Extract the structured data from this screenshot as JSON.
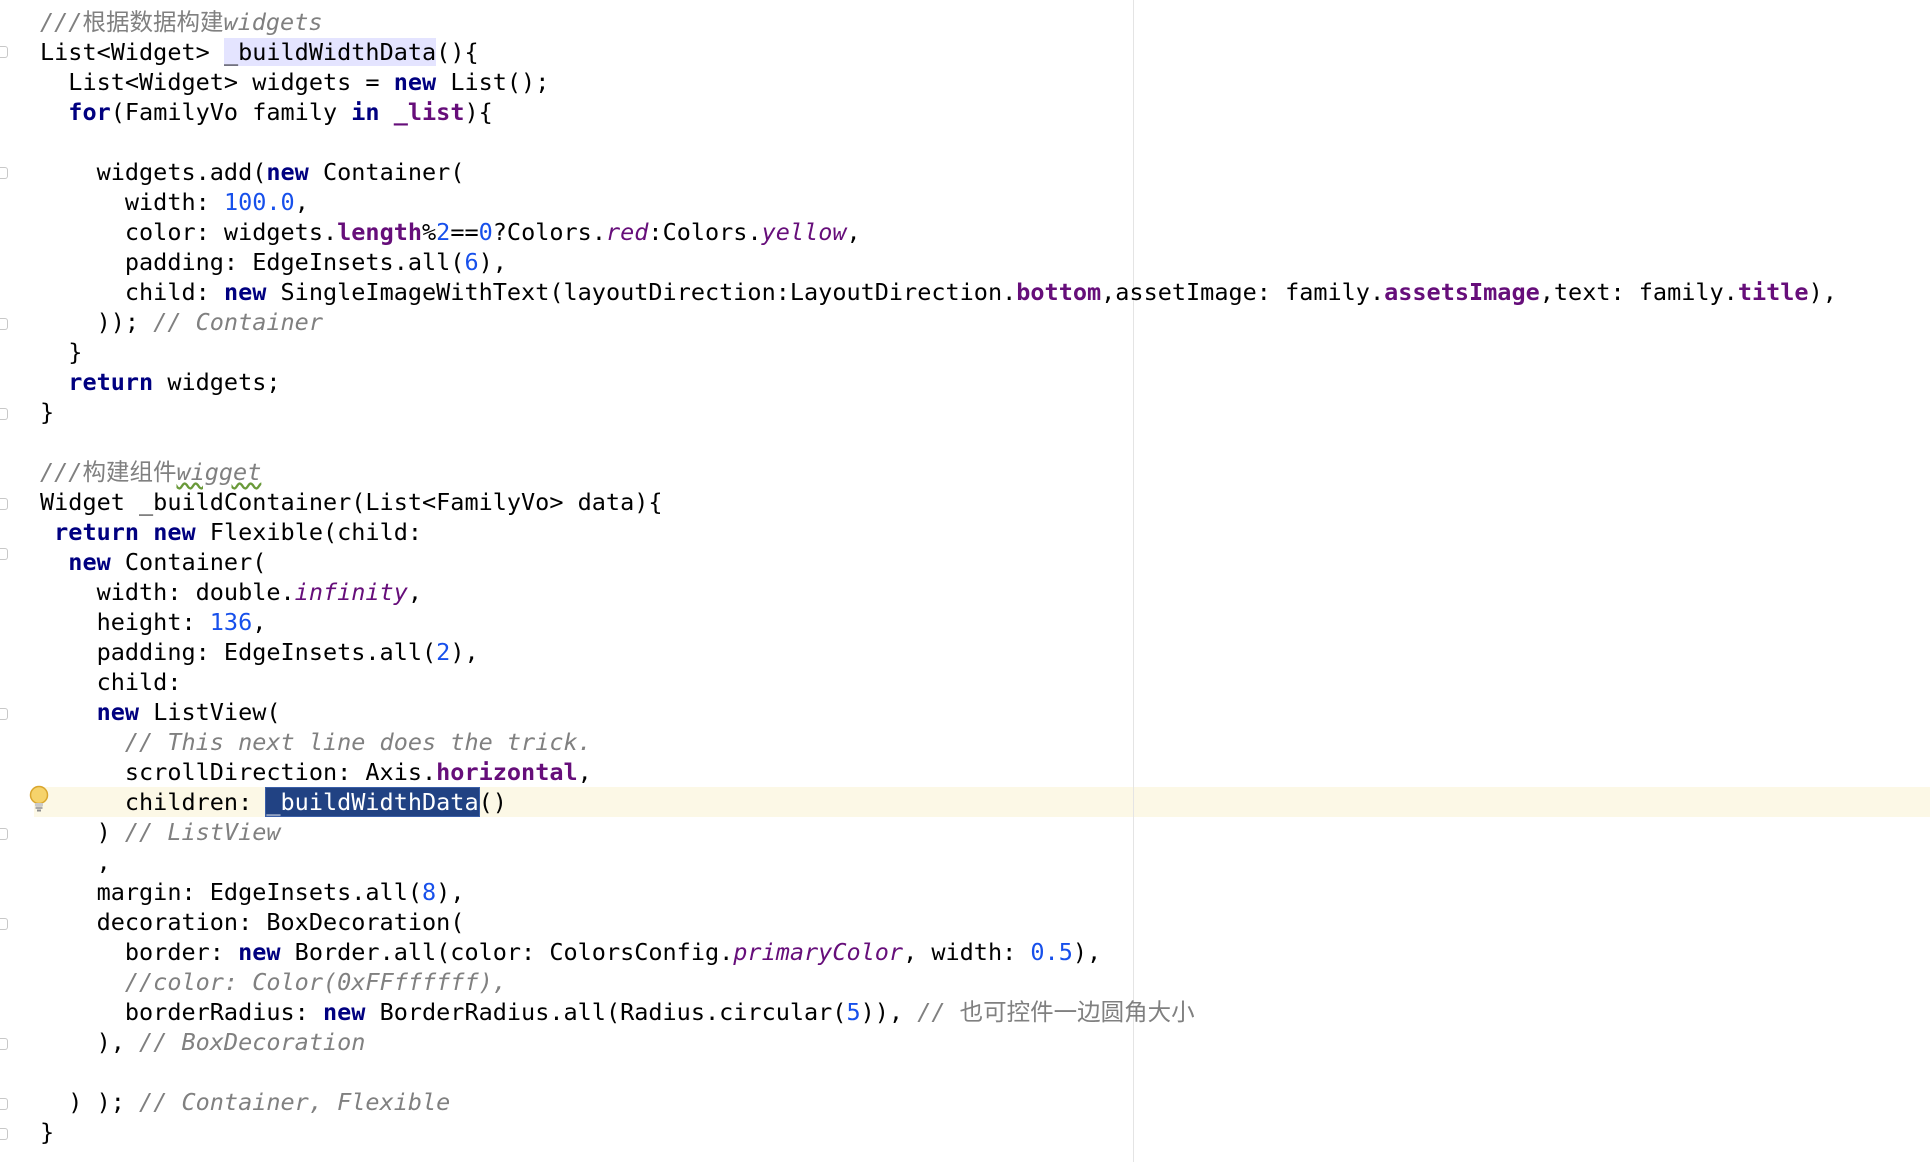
{
  "editor": {
    "current_line_index": 26,
    "lines": [
      [
        {
          "t": "///根据数据构建",
          "c": "cm"
        },
        {
          "t": "widgets",
          "c": "cm"
        }
      ],
      [
        {
          "t": "List<Widget> "
        },
        {
          "t": "_buildWidthData",
          "c": "ident-hl"
        },
        {
          "t": "(){"
        }
      ],
      [
        {
          "t": "  List<Widget> widgets = "
        },
        {
          "t": "new",
          "c": "kw"
        },
        {
          "t": " List();"
        }
      ],
      [
        {
          "t": "  "
        },
        {
          "t": "for",
          "c": "kw"
        },
        {
          "t": "(FamilyVo family "
        },
        {
          "t": "in",
          "c": "kw"
        },
        {
          "t": " "
        },
        {
          "t": "_list",
          "c": "fld"
        },
        {
          "t": "){"
        }
      ],
      [
        {
          "t": ""
        }
      ],
      [
        {
          "t": "    widgets.add("
        },
        {
          "t": "new",
          "c": "kw"
        },
        {
          "t": " Container("
        }
      ],
      [
        {
          "t": "      width: "
        },
        {
          "t": "100.0",
          "c": "num"
        },
        {
          "t": ","
        }
      ],
      [
        {
          "t": "      color: widgets."
        },
        {
          "t": "length",
          "c": "fld"
        },
        {
          "t": "%"
        },
        {
          "t": "2",
          "c": "num"
        },
        {
          "t": "=="
        },
        {
          "t": "0",
          "c": "num"
        },
        {
          "t": "?Colors."
        },
        {
          "t": "red",
          "c": "sfld"
        },
        {
          "t": ":Colors."
        },
        {
          "t": "yellow",
          "c": "sfld"
        },
        {
          "t": ","
        }
      ],
      [
        {
          "t": "      padding: EdgeInsets.all("
        },
        {
          "t": "6",
          "c": "num"
        },
        {
          "t": "),"
        }
      ],
      [
        {
          "t": "      child: "
        },
        {
          "t": "new",
          "c": "kw"
        },
        {
          "t": " SingleImageWithText(layoutDirection:LayoutDirection."
        },
        {
          "t": "bottom",
          "c": "fld"
        },
        {
          "t": ",assetImage: family."
        },
        {
          "t": "assetsImage",
          "c": "fld"
        },
        {
          "t": ",text: family."
        },
        {
          "t": "title",
          "c": "fld"
        },
        {
          "t": "),"
        }
      ],
      [
        {
          "t": "    )); "
        },
        {
          "t": "// Container",
          "c": "cm"
        }
      ],
      [
        {
          "t": "  }"
        }
      ],
      [
        {
          "t": "  "
        },
        {
          "t": "return",
          "c": "kw"
        },
        {
          "t": " widgets;"
        }
      ],
      [
        {
          "t": "}"
        }
      ],
      [
        {
          "t": ""
        }
      ],
      [
        {
          "t": "///构建组件",
          "c": "cm"
        },
        {
          "t": "wigget",
          "c": "cm squig"
        }
      ],
      [
        {
          "t": "Widget _buildContainer(List<FamilyVo> data){"
        }
      ],
      [
        {
          "t": " "
        },
        {
          "t": "return",
          "c": "kw"
        },
        {
          "t": " "
        },
        {
          "t": "new",
          "c": "kw"
        },
        {
          "t": " Flexible(child:"
        }
      ],
      [
        {
          "t": "  "
        },
        {
          "t": "new",
          "c": "kw"
        },
        {
          "t": " Container("
        }
      ],
      [
        {
          "t": "    width: double."
        },
        {
          "t": "infinity",
          "c": "sfld"
        },
        {
          "t": ","
        }
      ],
      [
        {
          "t": "    height: "
        },
        {
          "t": "136",
          "c": "num"
        },
        {
          "t": ","
        }
      ],
      [
        {
          "t": "    padding: EdgeInsets.all("
        },
        {
          "t": "2",
          "c": "num"
        },
        {
          "t": "),"
        }
      ],
      [
        {
          "t": "    child:"
        }
      ],
      [
        {
          "t": "    "
        },
        {
          "t": "new",
          "c": "kw"
        },
        {
          "t": " ListView("
        }
      ],
      [
        {
          "t": "      "
        },
        {
          "t": "// This next line does the trick.",
          "c": "cm"
        }
      ],
      [
        {
          "t": "      scrollDirection: Axis."
        },
        {
          "t": "horizontal",
          "c": "fld"
        },
        {
          "t": ","
        }
      ],
      [
        {
          "t": "      children: "
        },
        {
          "t": "_buildWidthData",
          "c": "sel"
        },
        {
          "t": "()"
        }
      ],
      [
        {
          "t": "    ) "
        },
        {
          "t": "// ListView",
          "c": "cm"
        }
      ],
      [
        {
          "t": "    ,"
        }
      ],
      [
        {
          "t": "    margin: EdgeInsets.all("
        },
        {
          "t": "8",
          "c": "num"
        },
        {
          "t": "),"
        }
      ],
      [
        {
          "t": "    decoration: BoxDecoration("
        }
      ],
      [
        {
          "t": "      border: "
        },
        {
          "t": "new",
          "c": "kw"
        },
        {
          "t": " Border.all(color: ColorsConfig."
        },
        {
          "t": "primaryColor",
          "c": "sfld"
        },
        {
          "t": ", width: "
        },
        {
          "t": "0.5",
          "c": "num"
        },
        {
          "t": "),"
        }
      ],
      [
        {
          "t": "      //color: Color(0xFFffffff),",
          "c": "cm"
        }
      ],
      [
        {
          "t": "      borderRadius: "
        },
        {
          "t": "new",
          "c": "kw"
        },
        {
          "t": " BorderRadius.all(Radius.circular("
        },
        {
          "t": "5",
          "c": "num"
        },
        {
          "t": ")), "
        },
        {
          "t": "// 也可控件一边圆角大小",
          "c": "cm cn-mix"
        }
      ],
      [
        {
          "t": "    ), "
        },
        {
          "t": "// BoxDecoration",
          "c": "cm"
        }
      ],
      [
        {
          "t": ""
        }
      ],
      [
        {
          "t": "  ) ); "
        },
        {
          "t": "// Container, Flexible",
          "c": "cm"
        }
      ],
      [
        {
          "t": "}"
        }
      ]
    ]
  },
  "gutter": {
    "intention_icon": "lightbulb-icon"
  },
  "colors": {
    "keyword": "#000080",
    "comment": "#808080",
    "number": "#1750eb",
    "field": "#660e7a",
    "selection": "#214283",
    "current_line": "#fcf8e6"
  }
}
